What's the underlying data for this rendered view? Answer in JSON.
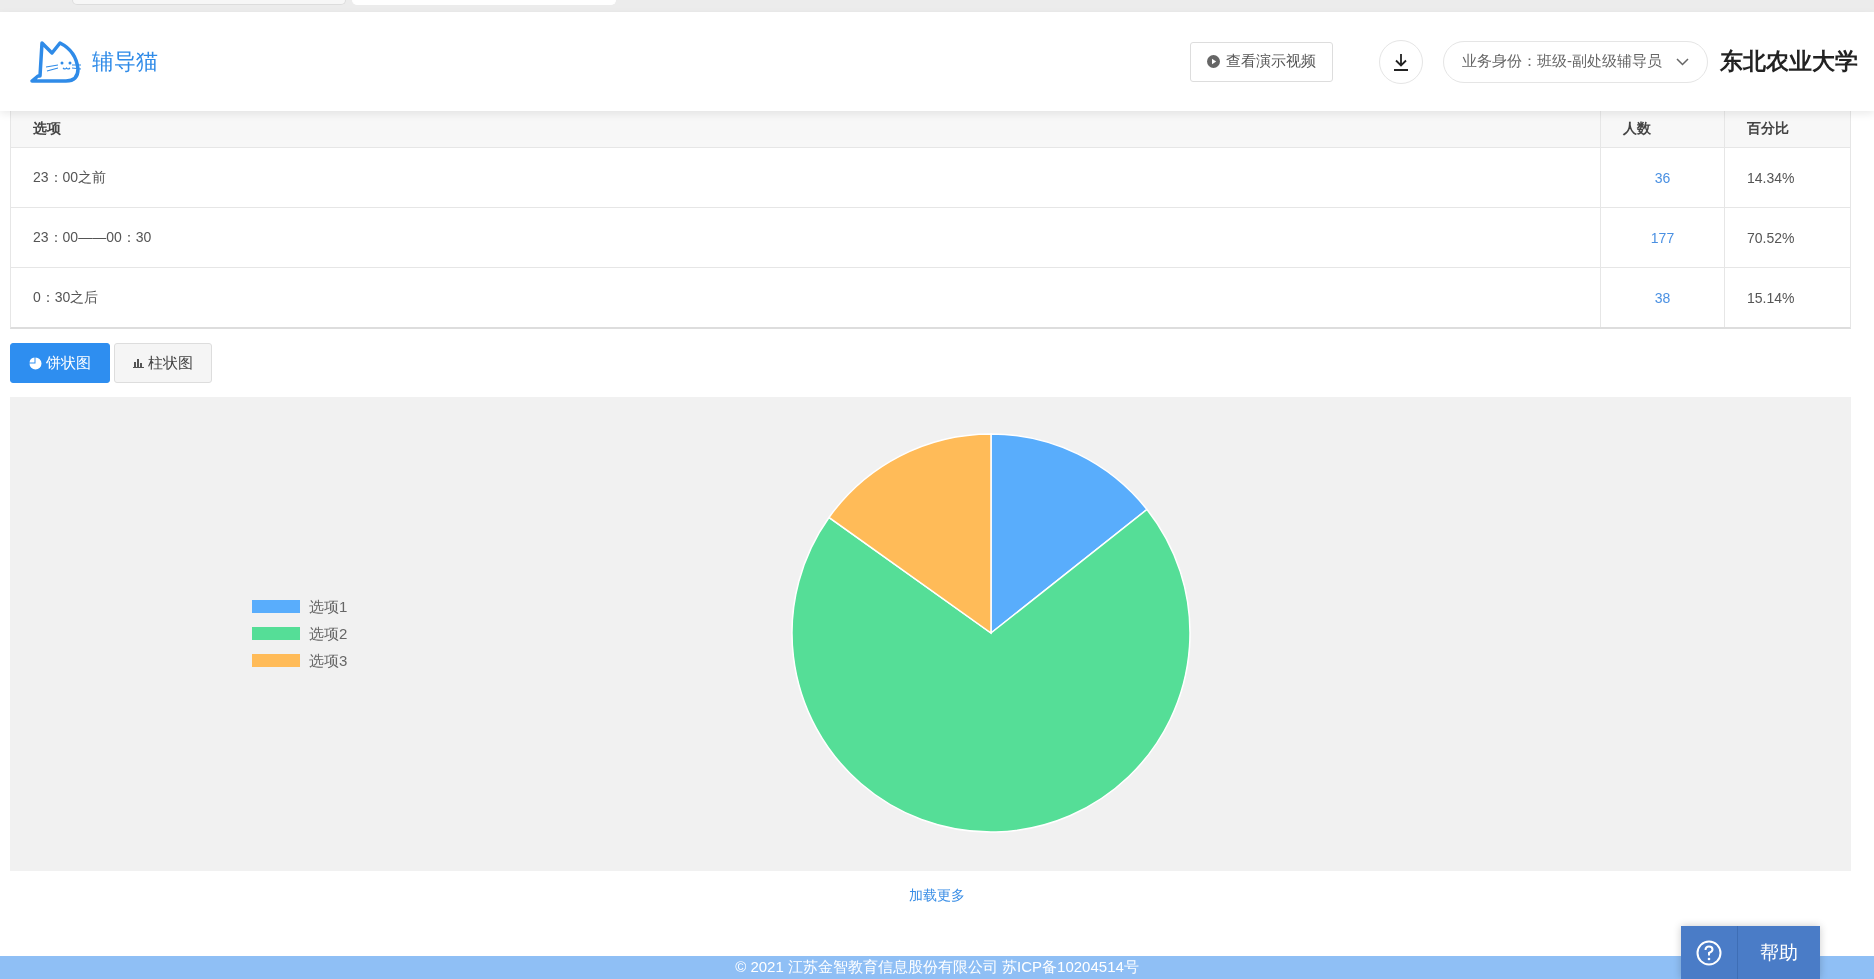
{
  "header": {
    "logo_text": "辅导猫",
    "demo_button": "查看演示视频",
    "role_select": "业务身份：班级-副处级辅导员",
    "school": "东北农业大学"
  },
  "table": {
    "columns": [
      "选项",
      "人数",
      "百分比"
    ],
    "rows": [
      {
        "option": "23：00之前",
        "count": "36",
        "percent": "14.34%"
      },
      {
        "option": "23：00——00：30",
        "count": "177",
        "percent": "70.52%"
      },
      {
        "option": "0：30之后",
        "count": "38",
        "percent": "15.14%"
      }
    ]
  },
  "chart_tabs": [
    {
      "label": "饼状图",
      "kind": "pie",
      "selected": true
    },
    {
      "label": "柱状图",
      "kind": "bar",
      "selected": false
    }
  ],
  "chart": {
    "chart_data": {
      "type": "pie",
      "legend": "left",
      "categories": [
        "选项1",
        "选项2",
        "选项3"
      ],
      "values": [
        14.34,
        70.52,
        15.14
      ],
      "colors": [
        "#59adfc",
        "#55de97",
        "#ffbb58"
      ]
    }
  },
  "load_more": "加载更多",
  "footer": "© 2021 江苏金智教育信息股份有限公司 苏ICP备10204514号",
  "help_button": "帮助"
}
